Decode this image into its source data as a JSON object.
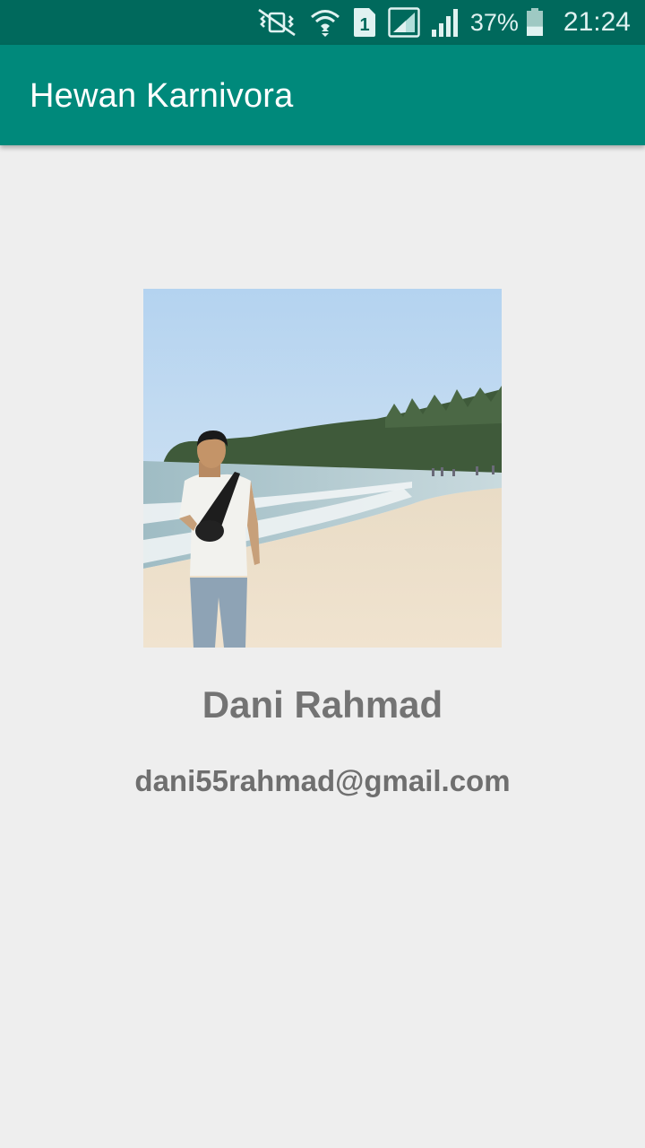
{
  "status_bar": {
    "battery_percent": "37%",
    "battery_level": 0.37,
    "time": "21:24",
    "sim_label": "1",
    "icons": [
      "vibrate-icon",
      "wifi-icon",
      "sim-1-icon",
      "signal-sim1-icon",
      "signal-sim2-icon",
      "battery-icon"
    ]
  },
  "app_bar": {
    "title": "Hewan Karnivora"
  },
  "profile": {
    "name": "Dani Rahmad",
    "email": "dani55rahmad@gmail.com"
  },
  "colors": {
    "status_bar": "#00695c",
    "app_bar": "#00897b",
    "background": "#eeeeee",
    "text_gray": "#737373"
  }
}
